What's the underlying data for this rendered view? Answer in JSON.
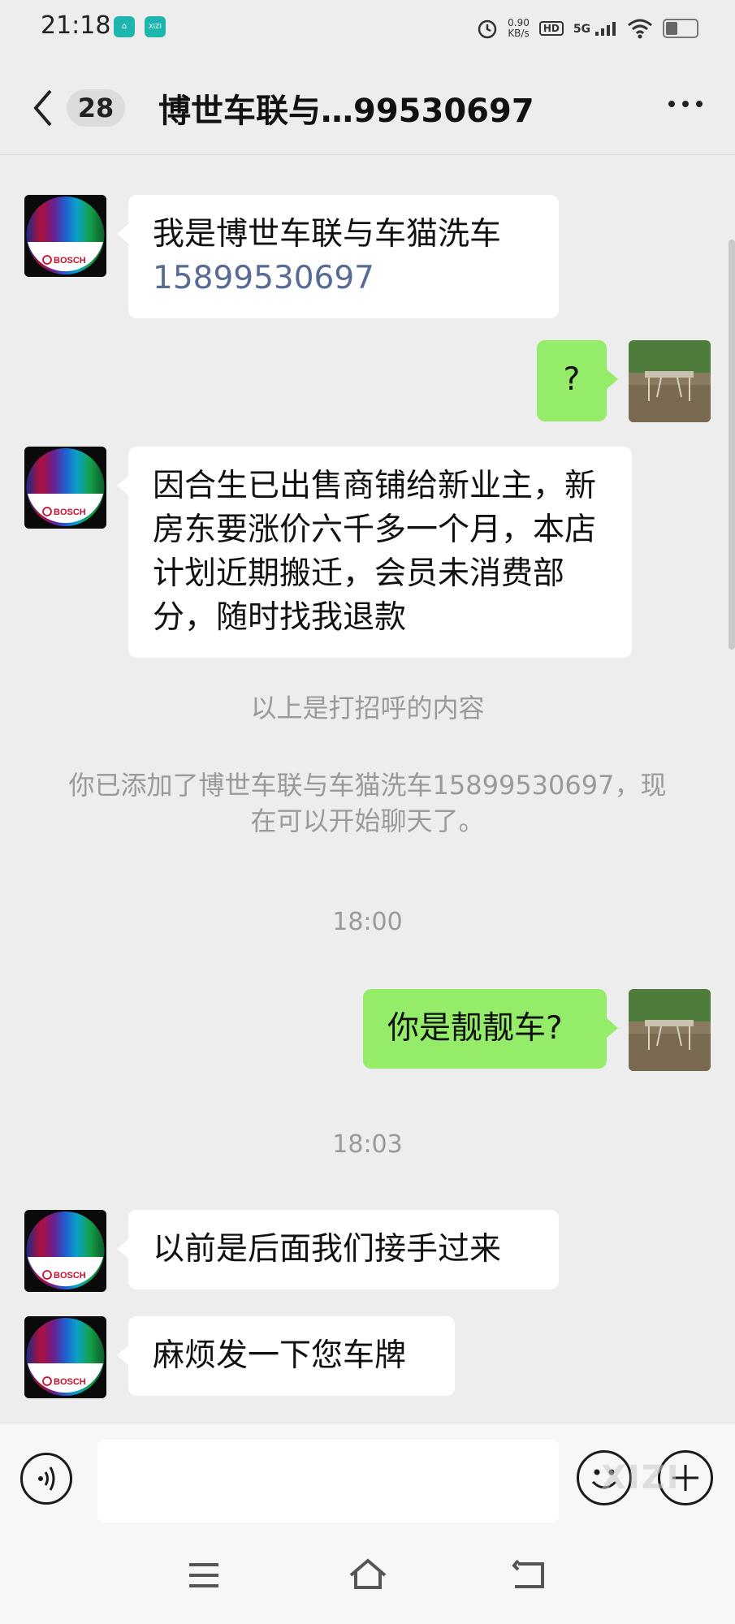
{
  "status_bar": {
    "time": "21:18",
    "app_icon_2_label": "XIZI",
    "net_speed_value": "0.90",
    "net_speed_unit": "KB/s",
    "hd_label": "HD",
    "network_label": "5G",
    "battery_level": 0.45
  },
  "header": {
    "unread_count": "28",
    "title": "博世车联与…99530697"
  },
  "messages": {
    "m1_text": "我是博世车联与车猫洗车",
    "m1_phone": "15899530697",
    "m2_text": "?",
    "m3_text": "因合生已出售商铺给新业主，新房东要涨价六千多一个月，本店计划近期搬迁，会员未消费部分，随时找我退款",
    "sys_greeting": "以上是打招呼的内容",
    "sys_added": "你已添加了博世车联与车猫洗车15899530697，现在可以开始聊天了。",
    "time_1": "18:00",
    "m4_text": "你是靓靓车?",
    "time_2": "18:03",
    "m5_text": "以前是后面我们接手过来",
    "m6_text": "麻烦发一下您车牌"
  },
  "contact": {
    "brand_label": "BOSCH"
  },
  "input": {
    "watermark": "XIZI"
  },
  "icons": {
    "back": "chevron-left-icon",
    "more": "more-horizontal-icon",
    "voice": "voice-icon",
    "emoji": "emoji-icon",
    "plus": "plus-icon",
    "menu": "menu-icon",
    "home": "home-icon",
    "return": "back-nav-icon"
  },
  "colors": {
    "background": "#ededed",
    "bubble_self": "#95ec69",
    "bubble_other": "#ffffff",
    "link": "#576b95"
  }
}
